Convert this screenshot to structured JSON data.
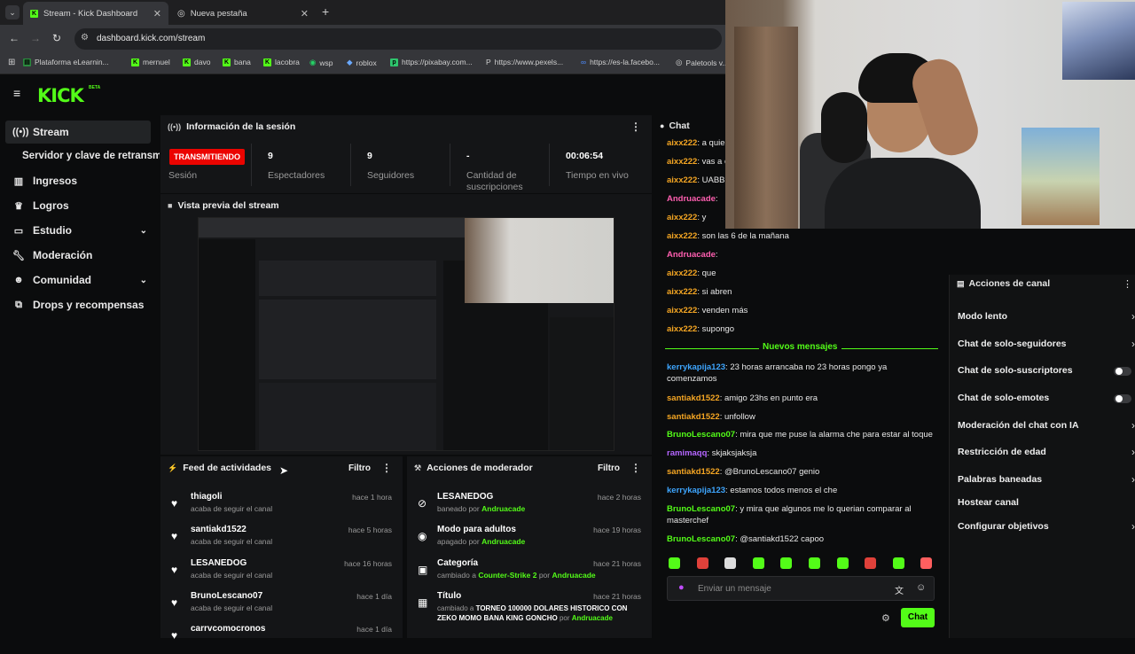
{
  "browser": {
    "tabs": [
      {
        "label": "Stream - Kick Dashboard",
        "active": true
      },
      {
        "label": "Nueva pestaña",
        "active": false
      }
    ],
    "url": "dashboard.kick.com/stream",
    "bookmarks": [
      "Plataforma eLearnin...",
      "mernuel",
      "davo",
      "bana",
      "lacobra",
      "wsp",
      "roblox",
      "https://pixabay.com...",
      "https://www.pexels...",
      "https://es-la.facebo...",
      "Paletools v..."
    ]
  },
  "app": {
    "logo": "KICK",
    "logo_tag": "BETA"
  },
  "sidebar": {
    "items": [
      {
        "label": "Stream",
        "icon": "stream-icon"
      },
      {
        "label": "Servidor y clave de retransmisión",
        "icon": ""
      },
      {
        "label": "Ingresos",
        "icon": "chart-icon"
      },
      {
        "label": "Logros",
        "icon": "trophy-icon"
      },
      {
        "label": "Estudio",
        "icon": "monitor-icon"
      },
      {
        "label": "Moderación",
        "icon": "wrench-icon"
      },
      {
        "label": "Comunidad",
        "icon": "people-icon"
      },
      {
        "label": "Drops y recompensas",
        "icon": "gift-icon"
      }
    ]
  },
  "session": {
    "title": "Información de la sesión",
    "status": "TRANSMITIENDO",
    "status_label": "Sesión",
    "stats": [
      {
        "value": "9",
        "label": "Espectadores"
      },
      {
        "value": "9",
        "label": "Seguidores"
      },
      {
        "value": "-",
        "label": "Cantidad de suscripciones"
      },
      {
        "value": "00:06:54",
        "label": "Tiempo en vivo"
      }
    ]
  },
  "preview": {
    "title": "Vista previa del stream"
  },
  "activity": {
    "title": "Feed de actividades",
    "filter": "Filtro",
    "items": [
      {
        "name": "thiagoli",
        "sub": "acaba de seguir el canal",
        "time": "hace 1 hora"
      },
      {
        "name": "santiakd1522",
        "sub": "acaba de seguir el canal",
        "time": "hace 5 horas"
      },
      {
        "name": "LESANEDOG",
        "sub": "acaba de seguir el canal",
        "time": "hace 16 horas"
      },
      {
        "name": "BrunoLescano07",
        "sub": "acaba de seguir el canal",
        "time": "hace 1 día"
      },
      {
        "name": "carrvcomocronos",
        "sub": "",
        "time": "hace 1 día"
      }
    ]
  },
  "modactions": {
    "title": "Acciones de moderador",
    "filter": "Filtro",
    "items": [
      {
        "name": "LESANEDOG",
        "sub_pre": "baneado por",
        "sub_user": "Andruacade",
        "time": "hace 2 horas"
      },
      {
        "name": "Modo para adultos",
        "sub_pre": "apagado por",
        "sub_user": "Andruacade",
        "time": "hace 19 horas"
      },
      {
        "name": "Categoría",
        "sub_pre": "cambiado a",
        "sub_mid": "Counter-Strike 2",
        "sub_by": "por",
        "sub_user": "Andruacade",
        "time": "hace 21 horas"
      },
      {
        "name": "Título",
        "sub_pre": "cambiado a",
        "sub_mid": "TORNEO 100000 DOLARES HISTORICO CON ZEKO MOMO BANA KING GONCHO",
        "sub_by": "por",
        "sub_user": "Andruacade",
        "time": "hace 21 horas"
      }
    ]
  },
  "chat": {
    "title": "Chat",
    "messages": [
      {
        "user": "aixx222",
        "text": "a quie",
        "color": "#f5a623"
      },
      {
        "user": "aixx222",
        "text": "vas a c",
        "color": "#f5a623"
      },
      {
        "user": "aixx222",
        "text": "UABBI",
        "color": "#f5a623"
      },
      {
        "user": "Andruacade",
        "text": "",
        "color": "#ff5fb0"
      },
      {
        "user": "aixx222",
        "text": "y",
        "color": "#f5a623"
      },
      {
        "user": "aixx222",
        "text": "son las 6 de la mañana",
        "color": "#f5a623"
      },
      {
        "user": "Andruacade",
        "text": "",
        "color": "#ff5fb0"
      },
      {
        "user": "aixx222",
        "text": "que",
        "color": "#f5a623"
      },
      {
        "user": "aixx222",
        "text": "si abren",
        "color": "#f5a623"
      },
      {
        "user": "aixx222",
        "text": "venden más",
        "color": "#f5a623"
      },
      {
        "user": "aixx222",
        "text": "supongo",
        "color": "#f5a623"
      }
    ],
    "new_divider": "Nuevos mensajes",
    "new_messages": [
      {
        "user": "kerrykapija123",
        "text": "23 horas arrancaba no 23 horas pongo ya comenzamos",
        "color": "#3ea6ff"
      },
      {
        "user": "santiakd1522",
        "text": "amigo 23hs en punto era",
        "color": "#f5a623"
      },
      {
        "user": "santiakd1522",
        "text": "unfollow",
        "color": "#f5a623"
      },
      {
        "user": "BrunoLescano07",
        "text": "mira que me puse la alarma che para estar al toque",
        "color": "#53fc18"
      },
      {
        "user": "ramimaqq",
        "text": "skjaksjaksja",
        "color": "#b566ff"
      },
      {
        "user": "santiakd1522",
        "text": "@BrunoLescano07 genio",
        "color": "#f5a623"
      },
      {
        "user": "kerrykapija123",
        "text": "estamos todos menos el che",
        "color": "#3ea6ff"
      },
      {
        "user": "BrunoLescano07",
        "text": "y mira que algunos me lo querian comparar al masterchef",
        "color": "#53fc18"
      },
      {
        "user": "BrunoLescano07",
        "text": "@santiakd1522 capoo",
        "color": "#53fc18"
      }
    ],
    "input_placeholder": "Enviar un mensaje",
    "send_label": "Chat"
  },
  "channel_actions": {
    "title": "Acciones de canal",
    "items": [
      {
        "label": "Modo lento",
        "control": "arrow"
      },
      {
        "label": "Chat de solo-seguidores",
        "control": "arrow"
      },
      {
        "label": "Chat de solo-suscriptores",
        "control": "toggle"
      },
      {
        "label": "Chat de solo-emotes",
        "control": "toggle"
      },
      {
        "label": "Moderación del chat con IA",
        "control": "arrow"
      },
      {
        "label": "Restricción de edad",
        "control": "arrow"
      },
      {
        "label": "Palabras baneadas",
        "control": "arrow"
      },
      {
        "label": "Hostear canal",
        "control": "none"
      },
      {
        "label": "Configurar objetivos",
        "control": "arrow"
      }
    ]
  },
  "colors": {
    "brand": "#53fc18",
    "live": "#eb0400"
  }
}
